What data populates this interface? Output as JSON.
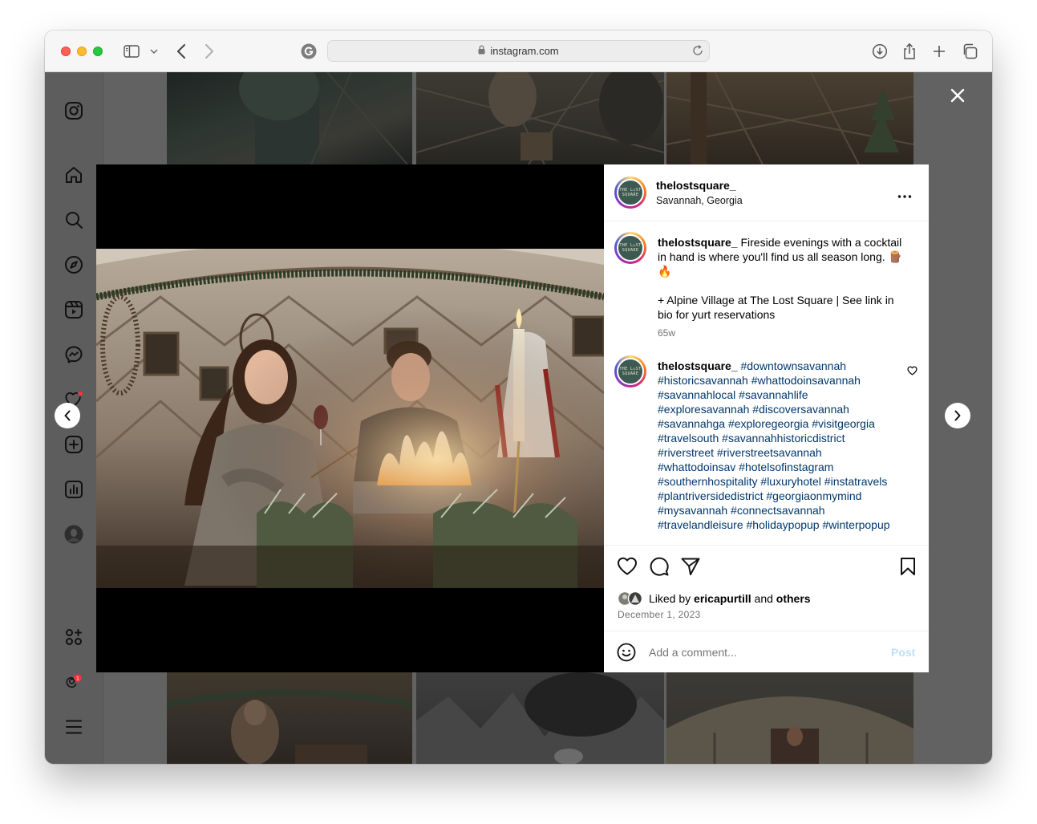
{
  "browser": {
    "url": "instagram.com",
    "icons": [
      "sidebar-toggle-icon",
      "chevron-down-icon",
      "back-icon",
      "forward-icon",
      "extension-icon",
      "lock-icon",
      "reload-icon",
      "downloads-icon",
      "share-icon",
      "new-tab-icon",
      "tab-overview-icon"
    ]
  },
  "sidebar": {
    "icons": [
      "instagram-logo-icon",
      "home-icon",
      "search-icon",
      "explore-icon",
      "reels-icon",
      "messages-icon",
      "notifications-icon",
      "create-icon",
      "dashboard-icon",
      "profile-avatar",
      "also-from-meta-icon",
      "threads-icon",
      "more-menu-icon"
    ],
    "threads_badge": "1"
  },
  "post": {
    "username": "thelostsquare_",
    "location": "Savannah, Georgia",
    "avatar_text": "THE L◇ST SQUARE",
    "caption": {
      "username": "thelostsquare_",
      "line1": "Fireside evenings with a cocktail in hand is where you'll find us all season long. 🪵🔥",
      "line2": "+ Alpine Village at The Lost Square | See link in bio for yurt reservations",
      "age": "65w"
    },
    "hashtag_comment": {
      "username": "thelostsquare_",
      "tags": "#downtownsavannah #historicsavannah #whattodoinsavannah #savannahlocal #savannahlife #exploresavannah #discoversavannah #savannahga #exploregeorgia #visitgeorgia #travelsouth #savannahhistoricdistrict #riverstreet #riverstreetsavannah #whattodoinsav #hotelsofinstagram #southernhospitality #luxuryhotel #instatravels #plantriversidedistrict #georgiaonmymind #mysavannah #connectsavannah #travelandleisure #holidaypopup #winterpopup"
    },
    "liked_by_prefix": "Liked by",
    "liked_by_user": "ericapurtill",
    "liked_by_and": "and",
    "liked_by_others": "others",
    "date": "December 1, 2023",
    "comment_placeholder": "Add a comment...",
    "post_button": "Post"
  },
  "colors": {
    "link": "#00376b",
    "post_button_disabled": "#c0dffd",
    "overlay": "#626262",
    "notification_dot": "#ff3040"
  }
}
